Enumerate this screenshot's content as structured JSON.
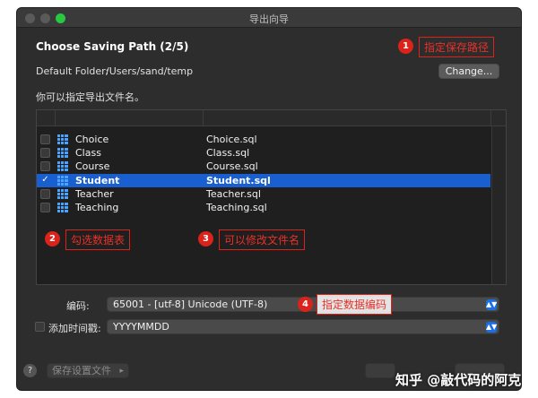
{
  "window": {
    "title": "导出向导"
  },
  "step": {
    "heading": "Choose Saving Path (2/5)"
  },
  "folder": {
    "label": "Default Folder:",
    "path": "/Users/sand/temp",
    "change_label": "Change..."
  },
  "hint": "你可以指定导出文件名。",
  "tables": [
    {
      "name": "Choice",
      "file": "Choice.sql",
      "checked": false
    },
    {
      "name": "Class",
      "file": "Class.sql",
      "checked": false
    },
    {
      "name": "Course",
      "file": "Course.sql",
      "checked": false
    },
    {
      "name": "Student",
      "file": "Student.sql",
      "checked": true
    },
    {
      "name": "Teacher",
      "file": "Teacher.sql",
      "checked": false
    },
    {
      "name": "Teaching",
      "file": "Teaching.sql",
      "checked": false
    }
  ],
  "check_mark": "✓",
  "annotations": {
    "a1": {
      "num": "1",
      "text": "指定保存路径"
    },
    "a2": {
      "num": "2",
      "text": "勾选数据表"
    },
    "a3": {
      "num": "3",
      "text": "可以修改文件名"
    },
    "a4": {
      "num": "4",
      "text": "指定数据编码"
    }
  },
  "encoding": {
    "label": "编码:",
    "value": "65001 - [utf-8] Unicode (UTF-8)"
  },
  "timestamp": {
    "label": "添加时间戳:",
    "value": "YYYYMMDD"
  },
  "footer": {
    "help": "?",
    "save_settings": "保存设置文件",
    "save_arrow": "▸"
  },
  "watermark": "知乎 @敲代码的阿克",
  "colors": {
    "accent": "#1a5fd0",
    "annotation": "#d9231b",
    "window_bg": "#2d2d2d"
  }
}
